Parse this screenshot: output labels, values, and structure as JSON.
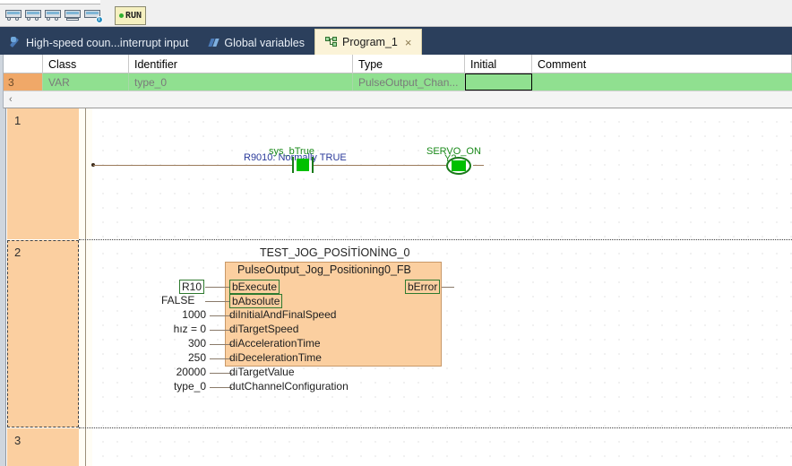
{
  "toolbar": {
    "buttons": [
      {
        "name": "plc-online-icon",
        "label": "PLC Online"
      },
      {
        "name": "plc-offline-icon",
        "label": "PLC Offline"
      },
      {
        "name": "plc-monitor-icon",
        "label": "PLC Monitor"
      },
      {
        "name": "plc-download-icon",
        "label": "PLC Download"
      },
      {
        "name": "plc-status-info-icon",
        "label": "PLC Status Info"
      }
    ],
    "run_button": {
      "label": "RUN",
      "dot_color": "#30b030",
      "bg_color": "#f5f0c0"
    }
  },
  "tabs": [
    {
      "label": "High-speed coun...interrupt input",
      "icon": "wrench-icon",
      "active": false,
      "closable": false
    },
    {
      "label": "Global variables",
      "icon": "variables-icon",
      "active": false,
      "closable": false
    },
    {
      "label": "Program_1",
      "icon": "program-block-icon",
      "active": true,
      "closable": true,
      "close_label": "×"
    }
  ],
  "variable_table": {
    "columns": [
      "",
      "Class",
      "Identifier",
      "Type",
      "Initial",
      "Comment"
    ],
    "rows": [
      {
        "index": "3",
        "class": "VAR",
        "identifier": "type_0",
        "type": "PulseOutput_Chan...",
        "initial": "",
        "comment": ""
      }
    ],
    "scroll_arrow": "‹",
    "row_color": "#90e090",
    "index_color": "#f0a868"
  },
  "ladder": {
    "rungs": [
      {
        "number": "1",
        "selected": false
      },
      {
        "number": "2",
        "selected": true
      },
      {
        "number": "3",
        "selected": false
      }
    ],
    "rung1": {
      "contact": {
        "label_top": "sys_bTrue",
        "label_bottom": "R9010: Normally TRUE",
        "type": "normally-open-contact"
      },
      "coil": {
        "label_top": "SERVO_ON",
        "label_bottom": "Y2",
        "type": "output-coil"
      }
    },
    "rung2": {
      "instance_name": "TEST_JOG_POSİTİONİNG_0",
      "fb_type": "PulseOutput_Jog_Positioning0_FB",
      "inputs": [
        {
          "value": "R10",
          "pin": "bExecute",
          "value_boxed": true,
          "pin_boxed": true
        },
        {
          "value": "FALSE",
          "pin": "bAbsolute",
          "value_boxed": false,
          "pin_boxed": true
        },
        {
          "value": "1000",
          "pin": "diInitialAndFinalSpeed",
          "value_boxed": false,
          "pin_boxed": false
        },
        {
          "value": "hız = 0",
          "pin": "diTargetSpeed",
          "value_boxed": false,
          "pin_boxed": false,
          "value_green_suffix": "0"
        },
        {
          "value": "300",
          "pin": "diAccelerationTime",
          "value_boxed": false,
          "pin_boxed": false
        },
        {
          "value": "250",
          "pin": "diDecelerationTime",
          "value_boxed": false,
          "pin_boxed": false
        },
        {
          "value": "20000",
          "pin": "diTargetValue",
          "value_boxed": false,
          "pin_boxed": false
        },
        {
          "value": "type_0",
          "pin": "dutChannelConfiguration",
          "value_boxed": false,
          "pin_boxed": false
        }
      ],
      "outputs": [
        {
          "pin": "bError",
          "pin_boxed": true
        }
      ]
    }
  },
  "colors": {
    "rung_panel": "#fbcfa0",
    "tabbar": "#2b3f5c",
    "active_tab": "#fbf3d8",
    "contact_green": "#00c000",
    "wire": "#9b7b5b",
    "label_green": "#1a8a1a",
    "label_blue": "#2a3a9a"
  }
}
